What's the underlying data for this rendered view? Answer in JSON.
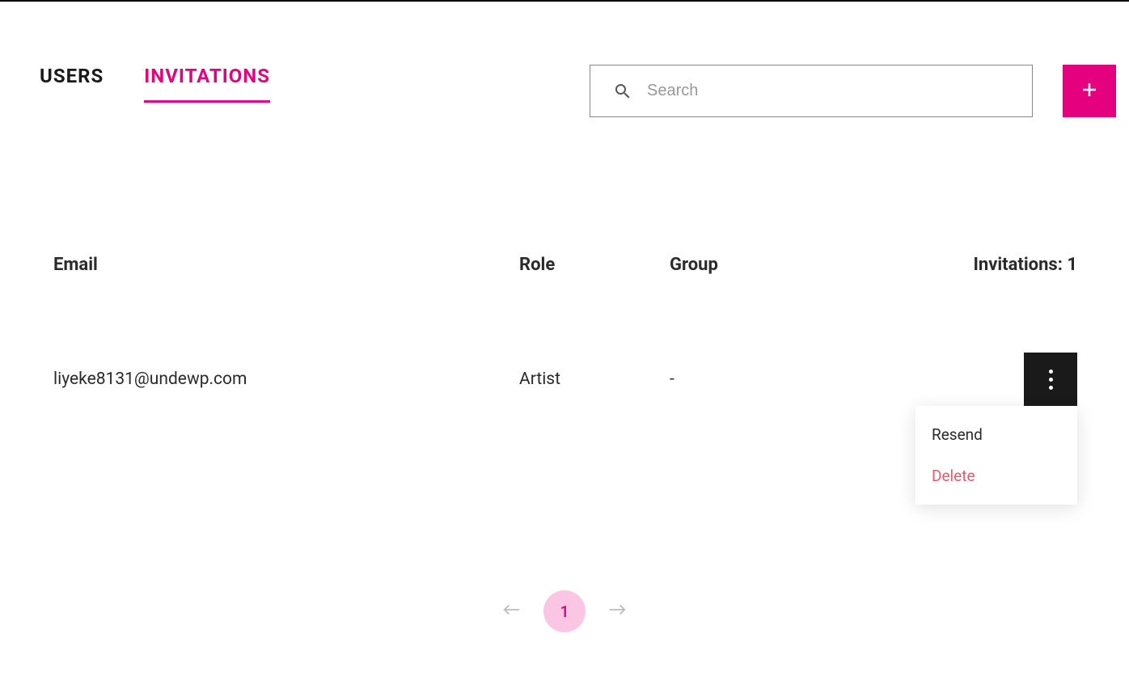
{
  "tabs": {
    "users": "USERS",
    "invitations": "INVITATIONS"
  },
  "search": {
    "placeholder": "Search",
    "value": ""
  },
  "table": {
    "headers": {
      "email": "Email",
      "role": "Role",
      "group": "Group",
      "count": "Invitations: 1"
    },
    "rows": [
      {
        "email": "liyeke8131@undewp.com",
        "role": "Artist",
        "group": "-"
      }
    ]
  },
  "menu": {
    "resend": "Resend",
    "delete": "Delete"
  },
  "pagination": {
    "current": "1"
  }
}
